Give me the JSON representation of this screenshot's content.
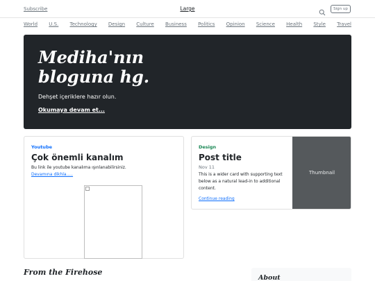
{
  "header": {
    "subscribe": "Subscribe",
    "brand": "Large",
    "signup": "Sign up"
  },
  "nav": [
    "World",
    "U.S.",
    "Technology",
    "Design",
    "Culture",
    "Business",
    "Politics",
    "Opinion",
    "Science",
    "Health",
    "Style",
    "Travel"
  ],
  "hero": {
    "title": "Mediha'nın bloguna hg.",
    "subtitle": "Dehşet içeriklere hazır olun.",
    "link": "Okumaya devam et..."
  },
  "cards": [
    {
      "category": "Youtube",
      "title": "Çok önemli kanalım",
      "text": "Bu link ile youtube kanalıma ışınlanabilirsiniz.",
      "link": "Devamına dikhla....."
    },
    {
      "category": "Design",
      "title": "Post title",
      "date": "Nov 11",
      "text": "This is a wider card with supporting text below as a natural lead-in to additional content.",
      "link": "Continue reading",
      "thumbnail": "Thumbnail"
    }
  ],
  "sections": {
    "firehose": "From the Firehose",
    "about": "About"
  },
  "colors": {
    "hero_bg": "#212529",
    "youtube_category": "#0d6efd",
    "design_category": "#198754",
    "thumbnail_bg": "#55595c"
  },
  "icons": [
    "search-icon",
    "broken-image-icon"
  ]
}
